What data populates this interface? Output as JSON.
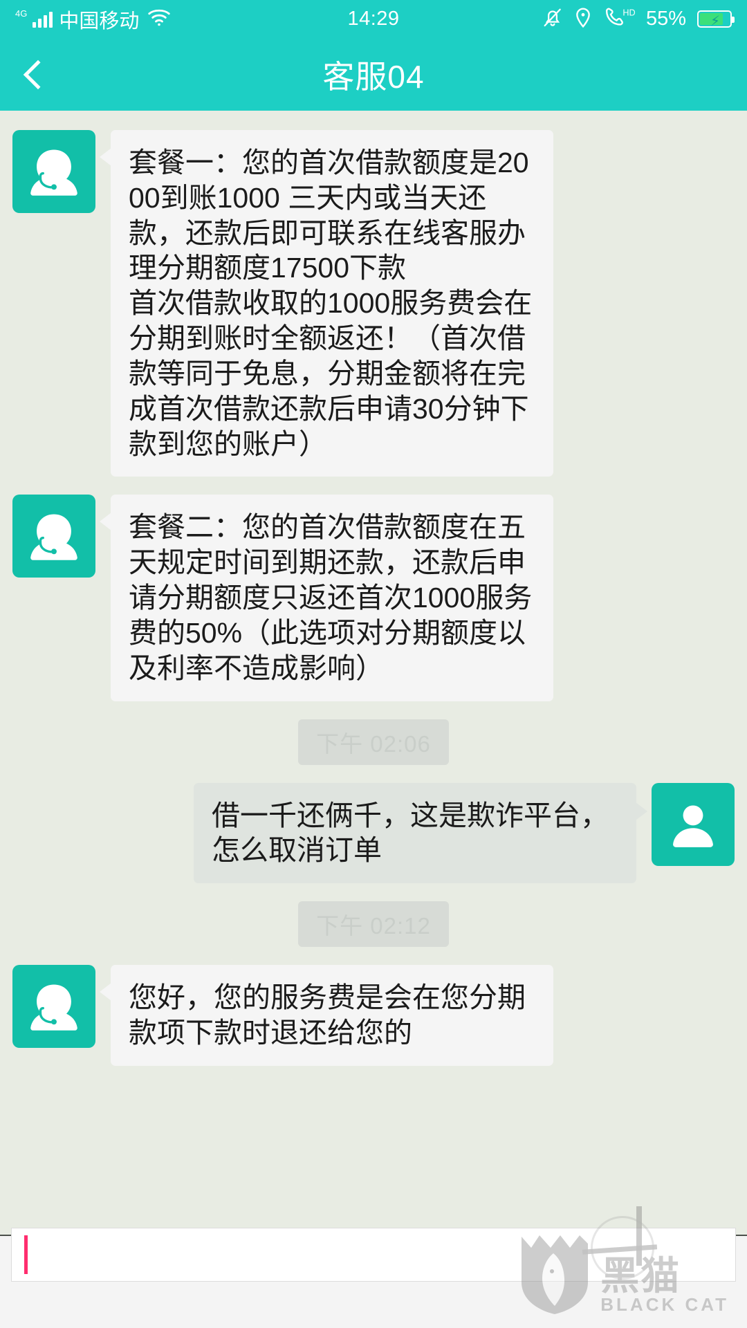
{
  "status_bar": {
    "network_tag": "4G",
    "carrier": "中国移动",
    "time": "14:29",
    "battery_percent": "55%",
    "icons": [
      "signal-bars-icon",
      "wifi-icon",
      "bell-muted-icon",
      "location-icon",
      "hd-call-icon",
      "battery-charging-icon"
    ]
  },
  "header": {
    "back_label": "",
    "title": "客服04"
  },
  "messages": [
    {
      "id": "msg-1",
      "side": "in",
      "sender": "agent",
      "avatar": "agent-headset-avatar",
      "text": "套餐一：您的首次借款额度是2000到账1000 三天内或当天还款，还款后即可联系在线客服办理分期额度17500下款\n首次借款收取的1000服务费会在分期到账时全额返还！（首次借款等同于免息，分期金额将在完成首次借款还款后申请30分钟下款到您的账户）"
    },
    {
      "id": "msg-2",
      "side": "in",
      "sender": "agent",
      "avatar": "agent-headset-avatar",
      "text": "套餐二：您的首次借款额度在五天规定时间到期还款，还款后申请分期额度只返还首次1000服务费的50%（此选项对分期额度以及利率不造成影响）"
    },
    {
      "id": "ts-1",
      "side": "center",
      "type": "timestamp",
      "text": "下午 02:06"
    },
    {
      "id": "msg-3",
      "side": "out",
      "sender": "user",
      "avatar": "user-person-avatar",
      "text": "借一千还俩千，这是欺诈平台，怎么取消订单"
    },
    {
      "id": "ts-2",
      "side": "center",
      "type": "timestamp",
      "text": "下午 02:12"
    },
    {
      "id": "msg-4",
      "side": "in",
      "sender": "agent",
      "avatar": "agent-headset-avatar",
      "text": "您好，您的服务费是会在您分期款项下款时退还给您的"
    }
  ],
  "input_bar": {
    "value": "",
    "placeholder": ""
  },
  "watermark": {
    "cn": "黑猫",
    "en": "BLACK CAT"
  },
  "colors": {
    "accent": "#1dcfc4",
    "avatar": "#12bfa8",
    "bubble_in": "#f5f5f5",
    "bubble_out": "#dfe4df",
    "page_bg": "#e8ece3",
    "caret": "#ff2d6e",
    "battery_fill": "#3ce07a"
  }
}
